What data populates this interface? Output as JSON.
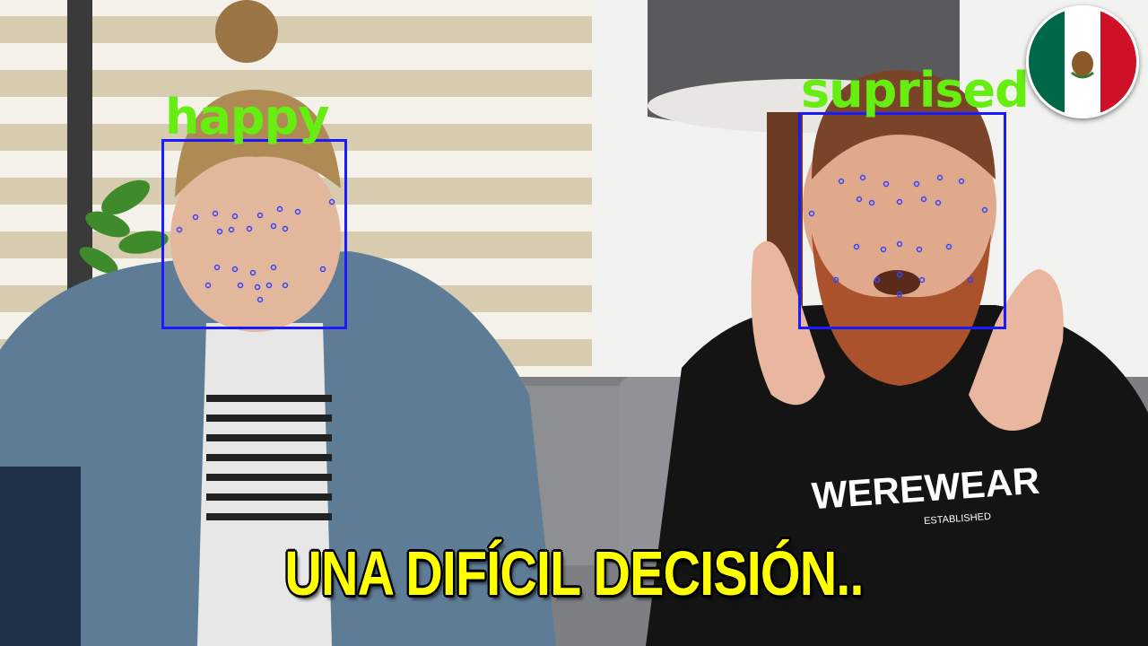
{
  "image": {
    "description_hint": "photo scene"
  },
  "faces": [
    {
      "emotion": "happy"
    },
    {
      "emotion": "suprised"
    }
  ],
  "caption": "UNA DIFÍCIL DECISIÓN..",
  "shirt_text": "WEREWEAR",
  "shirt_subtext": "ESTABLISHED",
  "colors": {
    "box": "#1a1aff",
    "label": "#66ee11",
    "caption": "#ffff00"
  },
  "flag": {
    "country_icon": "mexico-flag-icon"
  }
}
